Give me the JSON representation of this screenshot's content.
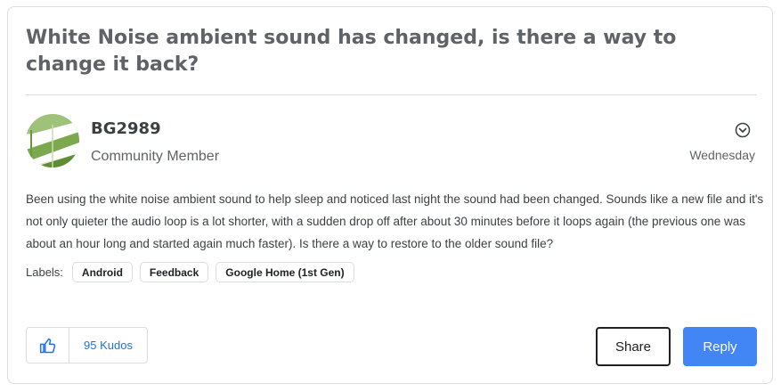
{
  "post": {
    "title": "White Noise ambient sound has changed, is there a way to change it back?",
    "author": {
      "username": "BG2989",
      "role": "Community Member",
      "avatar_icon": "green-window-avatar"
    },
    "menu_icon": "chevron-down-circle-icon",
    "date": "Wednesday",
    "body": "Been using the white noise ambient sound to help sleep and noticed last night the sound had been changed. Sounds like a new file and it's not only quieter the audio loop is a lot shorter, with a sudden drop off after about 30 minutes before it loops again (the previous one was about an hour long and started again much faster). Is there a way to restore to the older sound file?",
    "labels_caption": "Labels:",
    "labels": [
      "Android",
      "Feedback",
      "Google Home (1st Gen)"
    ]
  },
  "actions": {
    "thumb_icon": "thumbs-up-icon",
    "kudos": "95 Kudos",
    "share": "Share",
    "reply": "Reply"
  },
  "colors": {
    "accent": "#4285f4",
    "link": "#1a73e8",
    "border": "#dadce0",
    "title": "#5f6368"
  }
}
